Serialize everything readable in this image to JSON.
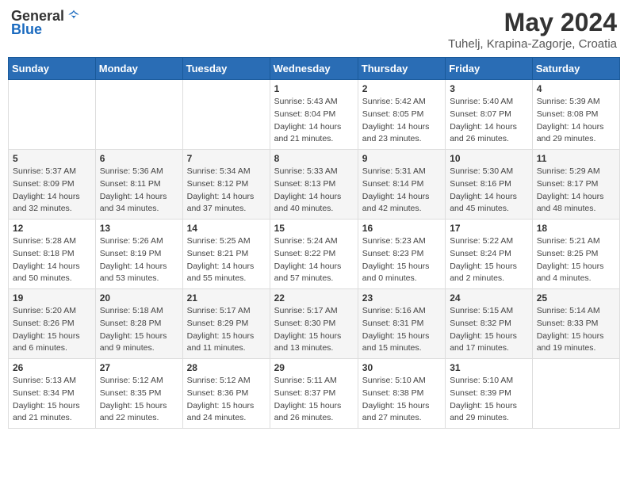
{
  "header": {
    "logo_general": "General",
    "logo_blue": "Blue",
    "month_year": "May 2024",
    "location": "Tuhelj, Krapina-Zagorje, Croatia"
  },
  "days_of_week": [
    "Sunday",
    "Monday",
    "Tuesday",
    "Wednesday",
    "Thursday",
    "Friday",
    "Saturday"
  ],
  "weeks": [
    [
      {
        "day": "",
        "info": ""
      },
      {
        "day": "",
        "info": ""
      },
      {
        "day": "",
        "info": ""
      },
      {
        "day": "1",
        "info": "Sunrise: 5:43 AM\nSunset: 8:04 PM\nDaylight: 14 hours\nand 21 minutes."
      },
      {
        "day": "2",
        "info": "Sunrise: 5:42 AM\nSunset: 8:05 PM\nDaylight: 14 hours\nand 23 minutes."
      },
      {
        "day": "3",
        "info": "Sunrise: 5:40 AM\nSunset: 8:07 PM\nDaylight: 14 hours\nand 26 minutes."
      },
      {
        "day": "4",
        "info": "Sunrise: 5:39 AM\nSunset: 8:08 PM\nDaylight: 14 hours\nand 29 minutes."
      }
    ],
    [
      {
        "day": "5",
        "info": "Sunrise: 5:37 AM\nSunset: 8:09 PM\nDaylight: 14 hours\nand 32 minutes."
      },
      {
        "day": "6",
        "info": "Sunrise: 5:36 AM\nSunset: 8:11 PM\nDaylight: 14 hours\nand 34 minutes."
      },
      {
        "day": "7",
        "info": "Sunrise: 5:34 AM\nSunset: 8:12 PM\nDaylight: 14 hours\nand 37 minutes."
      },
      {
        "day": "8",
        "info": "Sunrise: 5:33 AM\nSunset: 8:13 PM\nDaylight: 14 hours\nand 40 minutes."
      },
      {
        "day": "9",
        "info": "Sunrise: 5:31 AM\nSunset: 8:14 PM\nDaylight: 14 hours\nand 42 minutes."
      },
      {
        "day": "10",
        "info": "Sunrise: 5:30 AM\nSunset: 8:16 PM\nDaylight: 14 hours\nand 45 minutes."
      },
      {
        "day": "11",
        "info": "Sunrise: 5:29 AM\nSunset: 8:17 PM\nDaylight: 14 hours\nand 48 minutes."
      }
    ],
    [
      {
        "day": "12",
        "info": "Sunrise: 5:28 AM\nSunset: 8:18 PM\nDaylight: 14 hours\nand 50 minutes."
      },
      {
        "day": "13",
        "info": "Sunrise: 5:26 AM\nSunset: 8:19 PM\nDaylight: 14 hours\nand 53 minutes."
      },
      {
        "day": "14",
        "info": "Sunrise: 5:25 AM\nSunset: 8:21 PM\nDaylight: 14 hours\nand 55 minutes."
      },
      {
        "day": "15",
        "info": "Sunrise: 5:24 AM\nSunset: 8:22 PM\nDaylight: 14 hours\nand 57 minutes."
      },
      {
        "day": "16",
        "info": "Sunrise: 5:23 AM\nSunset: 8:23 PM\nDaylight: 15 hours\nand 0 minutes."
      },
      {
        "day": "17",
        "info": "Sunrise: 5:22 AM\nSunset: 8:24 PM\nDaylight: 15 hours\nand 2 minutes."
      },
      {
        "day": "18",
        "info": "Sunrise: 5:21 AM\nSunset: 8:25 PM\nDaylight: 15 hours\nand 4 minutes."
      }
    ],
    [
      {
        "day": "19",
        "info": "Sunrise: 5:20 AM\nSunset: 8:26 PM\nDaylight: 15 hours\nand 6 minutes."
      },
      {
        "day": "20",
        "info": "Sunrise: 5:18 AM\nSunset: 8:28 PM\nDaylight: 15 hours\nand 9 minutes."
      },
      {
        "day": "21",
        "info": "Sunrise: 5:17 AM\nSunset: 8:29 PM\nDaylight: 15 hours\nand 11 minutes."
      },
      {
        "day": "22",
        "info": "Sunrise: 5:17 AM\nSunset: 8:30 PM\nDaylight: 15 hours\nand 13 minutes."
      },
      {
        "day": "23",
        "info": "Sunrise: 5:16 AM\nSunset: 8:31 PM\nDaylight: 15 hours\nand 15 minutes."
      },
      {
        "day": "24",
        "info": "Sunrise: 5:15 AM\nSunset: 8:32 PM\nDaylight: 15 hours\nand 17 minutes."
      },
      {
        "day": "25",
        "info": "Sunrise: 5:14 AM\nSunset: 8:33 PM\nDaylight: 15 hours\nand 19 minutes."
      }
    ],
    [
      {
        "day": "26",
        "info": "Sunrise: 5:13 AM\nSunset: 8:34 PM\nDaylight: 15 hours\nand 21 minutes."
      },
      {
        "day": "27",
        "info": "Sunrise: 5:12 AM\nSunset: 8:35 PM\nDaylight: 15 hours\nand 22 minutes."
      },
      {
        "day": "28",
        "info": "Sunrise: 5:12 AM\nSunset: 8:36 PM\nDaylight: 15 hours\nand 24 minutes."
      },
      {
        "day": "29",
        "info": "Sunrise: 5:11 AM\nSunset: 8:37 PM\nDaylight: 15 hours\nand 26 minutes."
      },
      {
        "day": "30",
        "info": "Sunrise: 5:10 AM\nSunset: 8:38 PM\nDaylight: 15 hours\nand 27 minutes."
      },
      {
        "day": "31",
        "info": "Sunrise: 5:10 AM\nSunset: 8:39 PM\nDaylight: 15 hours\nand 29 minutes."
      },
      {
        "day": "",
        "info": ""
      }
    ]
  ]
}
